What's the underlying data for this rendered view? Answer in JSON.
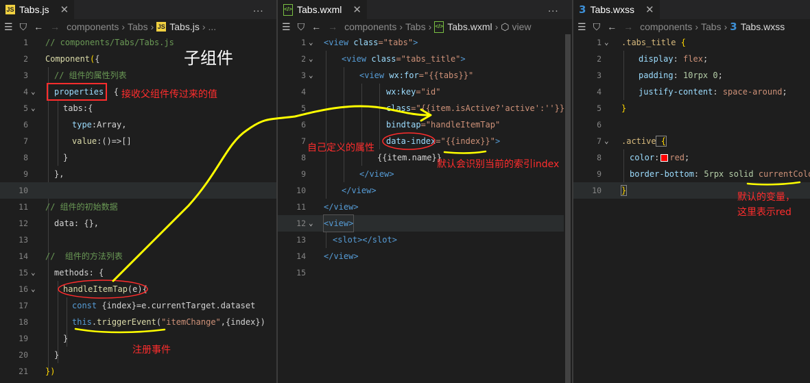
{
  "panes": {
    "js": {
      "tab_title": "Tabs.js",
      "file_icon": "js-file-icon",
      "breadcrumb": [
        "components",
        "Tabs",
        "Tabs.js",
        "..."
      ],
      "lines": [
        "1",
        "2",
        "3",
        "4",
        "5",
        "6",
        "7",
        "8",
        "9",
        "10",
        "11",
        "12",
        "13",
        "14",
        "15",
        "16",
        "17",
        "18",
        "19",
        "20",
        "21"
      ],
      "code": {
        "l1": "// components/Tabs/Tabs.js",
        "l2a": "Component",
        "l2b": "(",
        "l2c": "{",
        "l3": "// 组件的属性列表",
        "l4a": "properties",
        "l4b": ": {",
        "l5": "tabs:{",
        "l6a": "type",
        "l6b": ":Array,",
        "l7a": "value",
        "l7b": ":()=>[]",
        "l8": "}",
        "l9": "},",
        "l11": "// 组件的初始数据",
        "l12": "data: {},",
        "l14": "//  组件的方法列表",
        "l15": "methods: {",
        "l16a": "handleItemTap",
        "l16b": "(e){",
        "l17a": "const",
        "l17b": " {index}=e.currentTarget.dataset",
        "l18a": "this",
        "l18b": ".",
        "l18c": "triggerEvent",
        "l18d": "(",
        "l18e": "\"itemChange\"",
        "l18f": ",{index})",
        "l19": "}",
        "l20": "}",
        "l21": "})"
      }
    },
    "wxml": {
      "tab_title": "Tabs.wxml",
      "file_icon": "wxml-file-icon",
      "breadcrumb": [
        "components",
        "Tabs",
        "Tabs.wxml",
        "view"
      ],
      "lines": [
        "1",
        "2",
        "3",
        "4",
        "5",
        "6",
        "7",
        "8",
        "9",
        "10",
        "11",
        "12",
        "13",
        "14",
        "15"
      ],
      "code": {
        "l1a": "<view",
        "l1b": " class",
        "l1c": "=\"tabs\"",
        "l1d": ">",
        "l2a": "<view",
        "l2b": " class",
        "l2c": "=\"tabs_title\"",
        "l2d": ">",
        "l3a": "<view",
        "l3b": " wx:for",
        "l3c": "=\"{{tabs}}\"",
        "l4a": "wx:key",
        "l4b": "=\"id\"",
        "l5a": "class",
        "l5b": "=\"{{item.isActive?'active':''}}\"",
        "l6a": "bindtap",
        "l6b": "=\"handleItemTap\"",
        "l7a": "data-index",
        "l7b": "=\"{{index}}\"",
        "l7c": ">",
        "l8": "{{item.name}}",
        "l9": "</view>",
        "l10": "</view>",
        "l11": "</view>",
        "l12": "<view>",
        "l13": "<slot></slot>",
        "l14": "</view>"
      }
    },
    "wxss": {
      "tab_title": "Tabs.wxss",
      "file_icon": "css-file-icon",
      "breadcrumb": [
        "components",
        "Tabs",
        "Tabs.wxss"
      ],
      "lines": [
        "1",
        "2",
        "3",
        "4",
        "5",
        "6",
        "7",
        "8",
        "9",
        "10"
      ],
      "code": {
        "l1a": ".tabs_title",
        "l1b": " {",
        "l2a": "display",
        "l2b": ": ",
        "l2c": "flex",
        "l2d": ";",
        "l3a": "padding",
        "l3b": ": ",
        "l3c": "10rpx 0",
        "l3d": ";",
        "l4a": "justify-content",
        "l4b": ": ",
        "l4c": "space-around",
        "l4d": ";",
        "l5": "}",
        "l7a": ".active",
        "l7b": " {",
        "l8a": "color",
        "l8b": ":",
        "l8c": "red",
        "l8d": ";",
        "l9a": "border-bottom",
        "l9b": ": ",
        "l9c": "5rpx solid",
        "l9d": " currentColor",
        "l9e": ";",
        "l10": "}"
      }
    }
  },
  "annotations": {
    "child_component": "子组件",
    "receive_props": "接收父组件传过来的值",
    "register_event": "注册事件",
    "custom_attr": "自己定义的属性",
    "default_index": "默认会识别当前的索引index",
    "default_var_1": "默认的变量，",
    "default_var_2": "这里表示red"
  },
  "colors": {
    "background": "#1e1e1e",
    "annotation_red": "#ff2d2d",
    "highlight_yellow": "#ffff00",
    "swatch_red": "#ff0000"
  },
  "more_label": "..."
}
